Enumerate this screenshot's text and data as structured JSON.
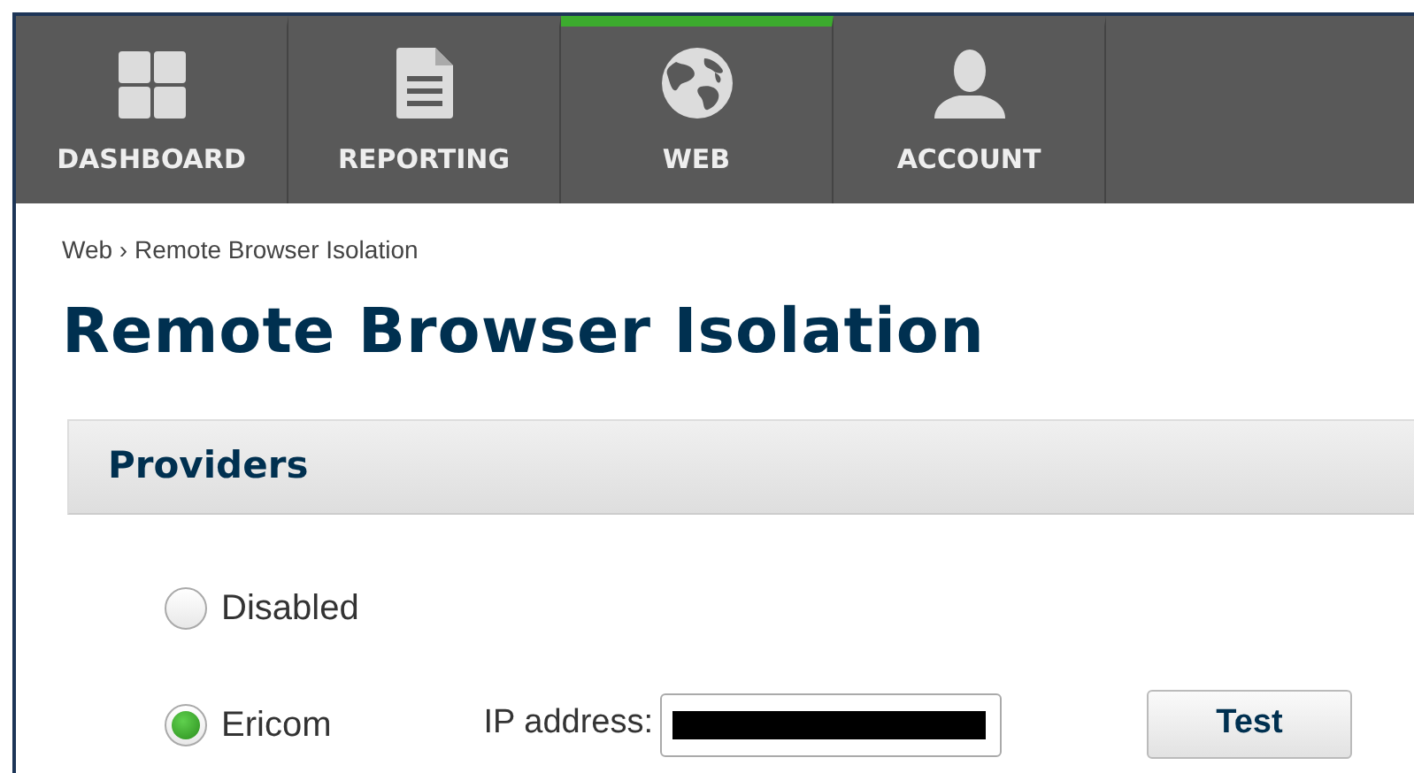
{
  "nav": {
    "tabs": [
      {
        "label": "DASHBOARD",
        "selected": false
      },
      {
        "label": "REPORTING",
        "selected": false
      },
      {
        "label": "WEB",
        "selected": true
      },
      {
        "label": "ACCOUNT",
        "selected": false
      }
    ]
  },
  "breadcrumb": {
    "items": [
      "Web",
      "Remote Browser Isolation"
    ],
    "separator": "›"
  },
  "page_title": "Remote Browser Isolation",
  "section": {
    "title": "Providers",
    "options": [
      {
        "label": "Disabled",
        "selected": false
      },
      {
        "label": "Ericom",
        "selected": true,
        "ip_label": "IP address:",
        "ip_redacted": true,
        "button": "Test"
      }
    ]
  }
}
